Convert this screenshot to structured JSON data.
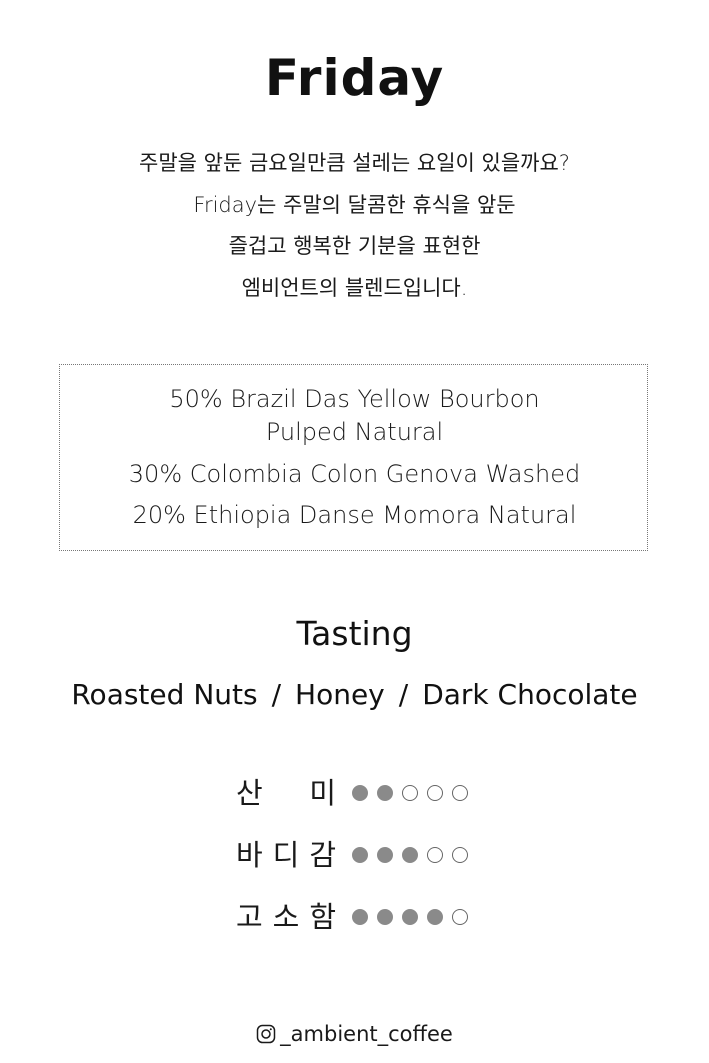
{
  "title": "Friday",
  "intro": [
    "주말을 앞둔 금요일만큼 설레는 요일이 있을까요?",
    "Friday는 주말의 달콤한 휴식을 앞둔",
    "즐겁고 행복한 기분을 표현한",
    "엠비언트의 블렌드입니다."
  ],
  "blend": [
    "50%  Brazil Das Yellow Bourbon",
    "Pulped Natural",
    "30%  Colombia Colon Genova Washed",
    "20%  Ethiopia Danse Momora Natural"
  ],
  "tasting": {
    "title": "Tasting",
    "notes": [
      "Roasted Nuts",
      "Honey",
      "Dark Chocolate"
    ],
    "separator": "/"
  },
  "ratings": [
    {
      "label_chars": [
        "산",
        "미"
      ],
      "score": 2,
      "max": 5
    },
    {
      "label_chars": [
        "바",
        "디",
        "감"
      ],
      "score": 3,
      "max": 5
    },
    {
      "label_chars": [
        "고",
        "소",
        "함"
      ],
      "score": 4,
      "max": 5
    }
  ],
  "colors": {
    "dot_filled": "#8a8a8a",
    "dot_empty_border": "#666666",
    "text": "#111111"
  },
  "footer": {
    "icon": "instagram-icon",
    "handle": "_ambient_coffee"
  }
}
